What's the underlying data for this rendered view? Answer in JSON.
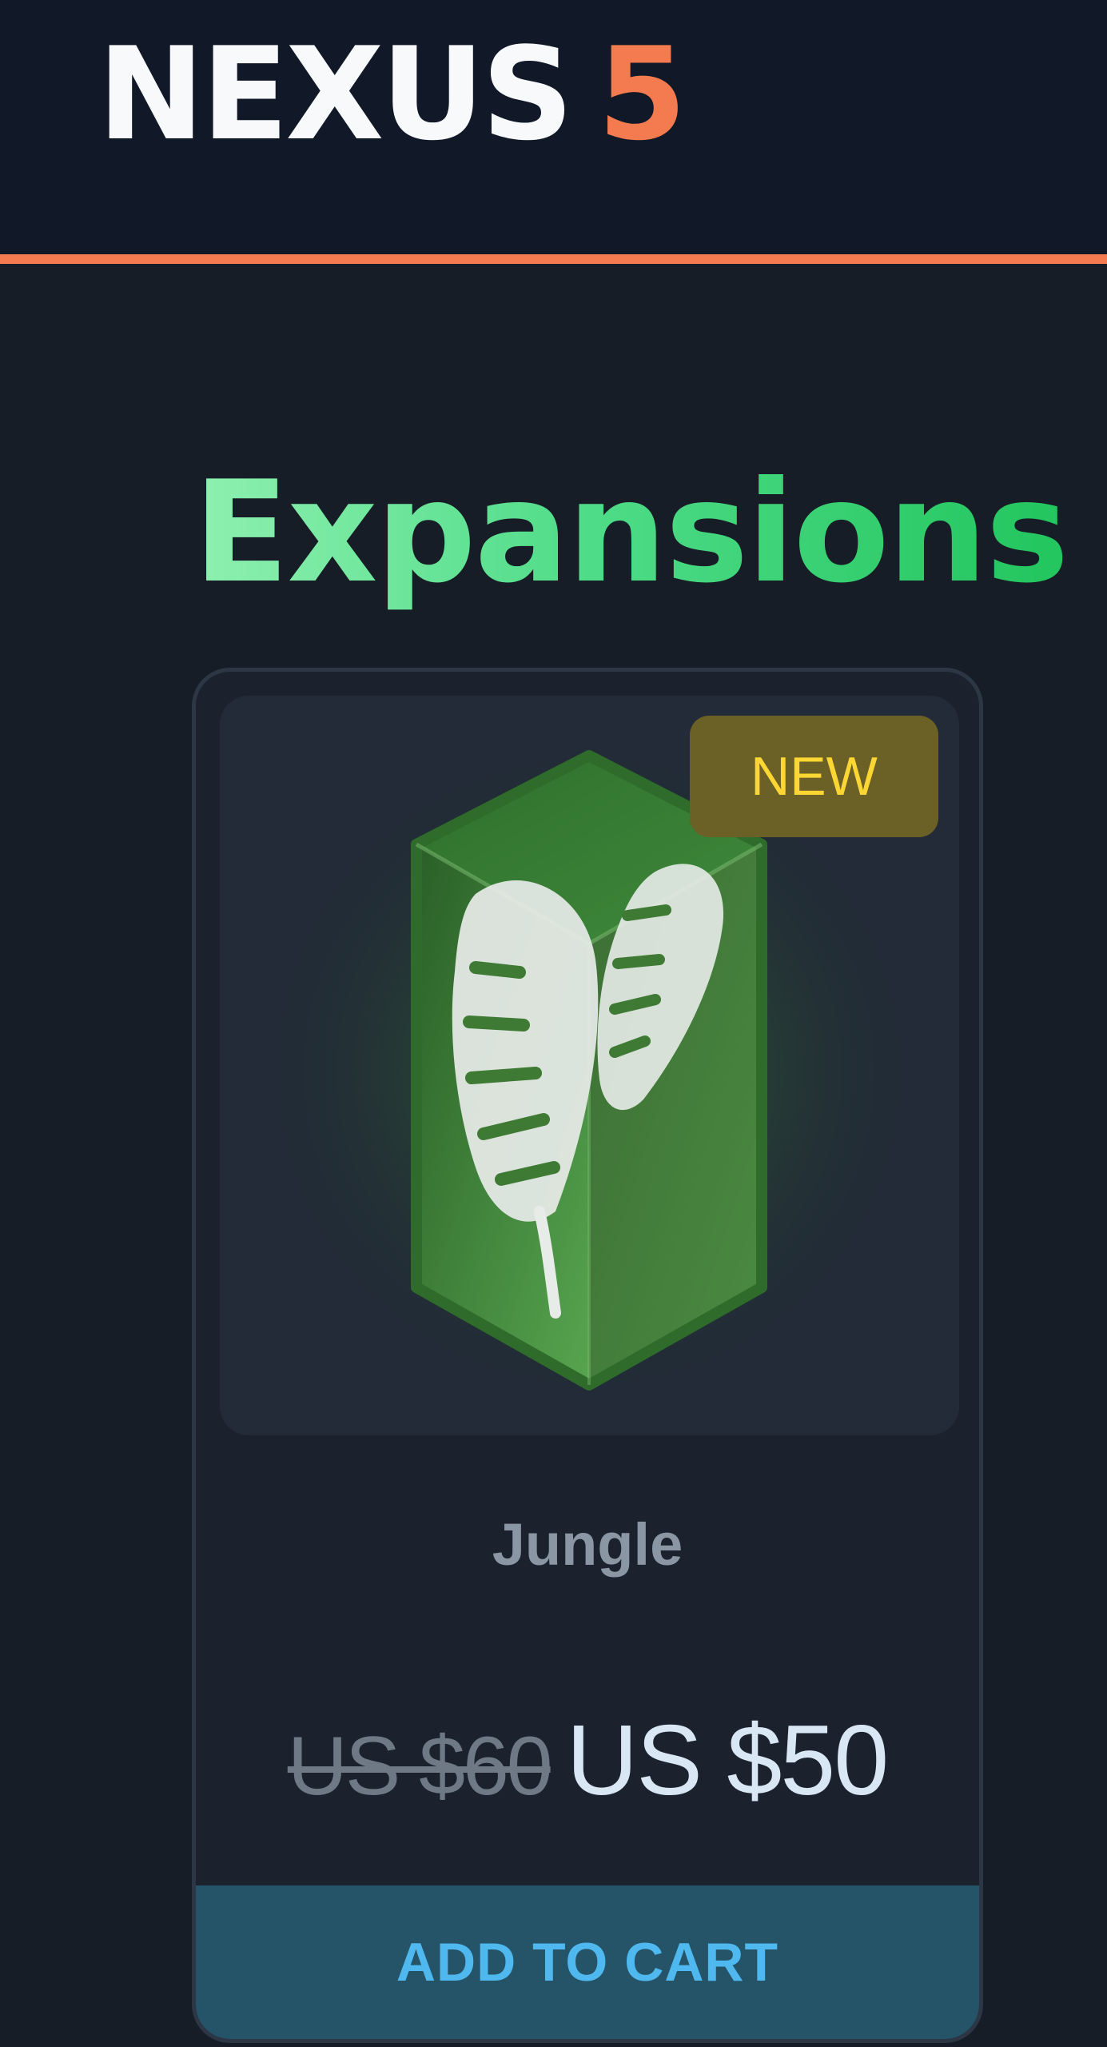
{
  "header": {
    "logo_word": "NEXUS",
    "logo_number": "5",
    "colors": {
      "background": "#111827",
      "accent": "#f47a4f",
      "logo_text": "#f7f9fb"
    }
  },
  "page": {
    "title": "Expansions",
    "background": "#171d26"
  },
  "product": {
    "badge": "NEW",
    "image_icon": "leaf-cube-icon",
    "name": "Jungle",
    "original_price": "US $60",
    "sale_price": "US $50",
    "cta_label": "ADD TO CART",
    "colors": {
      "cube_green": "#3f7a35",
      "badge_bg": "#6b6025",
      "badge_text": "#fcd733",
      "cta_bg": "#255468",
      "cta_text": "#4fb8ee"
    }
  }
}
